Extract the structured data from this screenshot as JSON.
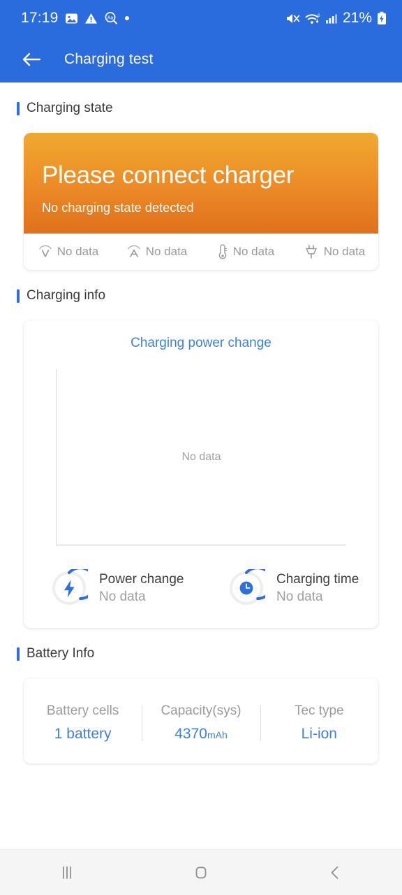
{
  "status_bar": {
    "time": "17:19",
    "battery_percent": "21%",
    "left_icons": [
      "image-icon",
      "warning-triangle-icon",
      "text-search-icon",
      "dot-icon"
    ],
    "right_icons": [
      "mute-icon",
      "wifi-icon",
      "cellular-signal-icon",
      "battery-charging-icon"
    ]
  },
  "app_bar": {
    "back_icon": "back-arrow-icon",
    "title": "Charging test"
  },
  "sections": {
    "charging_state": {
      "title": "Charging state"
    },
    "charging_info": {
      "title": "Charging info"
    },
    "battery_info": {
      "title": "Battery Info"
    }
  },
  "charging_state": {
    "headline": "Please connect charger",
    "subtitle": "No charging state detected",
    "metrics": [
      {
        "icon": "voltage-icon",
        "label": "No data"
      },
      {
        "icon": "amperage-icon",
        "label": "No data"
      },
      {
        "icon": "thermometer-icon",
        "label": "No data"
      },
      {
        "icon": "plug-icon",
        "label": "No data"
      }
    ]
  },
  "charging_info": {
    "chart_title": "Charging power change",
    "chart_empty_text": "No data",
    "stats": [
      {
        "icon": "lightning-bolt-ring-icon",
        "name": "Power change",
        "value": "No data"
      },
      {
        "icon": "clock-ring-icon",
        "name": "Charging time",
        "value": "No data"
      }
    ]
  },
  "battery_info": {
    "columns": [
      {
        "label": "Battery cells",
        "value": "1 battery",
        "unit": ""
      },
      {
        "label": "Capacity(sys)",
        "value": "4370",
        "unit": "mAh"
      },
      {
        "label": "Tec type",
        "value": "Li-ion",
        "unit": ""
      }
    ]
  },
  "nav_bar": {
    "recents_icon": "recents-icon",
    "home_icon": "home-icon",
    "back_icon": "nav-back-icon"
  },
  "colors": {
    "header_blue": "#2a6bdd",
    "accent_blue": "#2f6fd8",
    "link_blue": "#3d82d8",
    "gradient_top": "#f0a92f",
    "gradient_bottom": "#e0701c",
    "muted_gray": "#9a9a9a"
  },
  "chart_data": {
    "type": "line",
    "title": "Charging power change",
    "x": [],
    "series": [
      {
        "name": "Charging power",
        "values": []
      }
    ],
    "xlabel": "",
    "ylabel": "",
    "grid": false,
    "legend": "none",
    "empty_state": "No data"
  }
}
